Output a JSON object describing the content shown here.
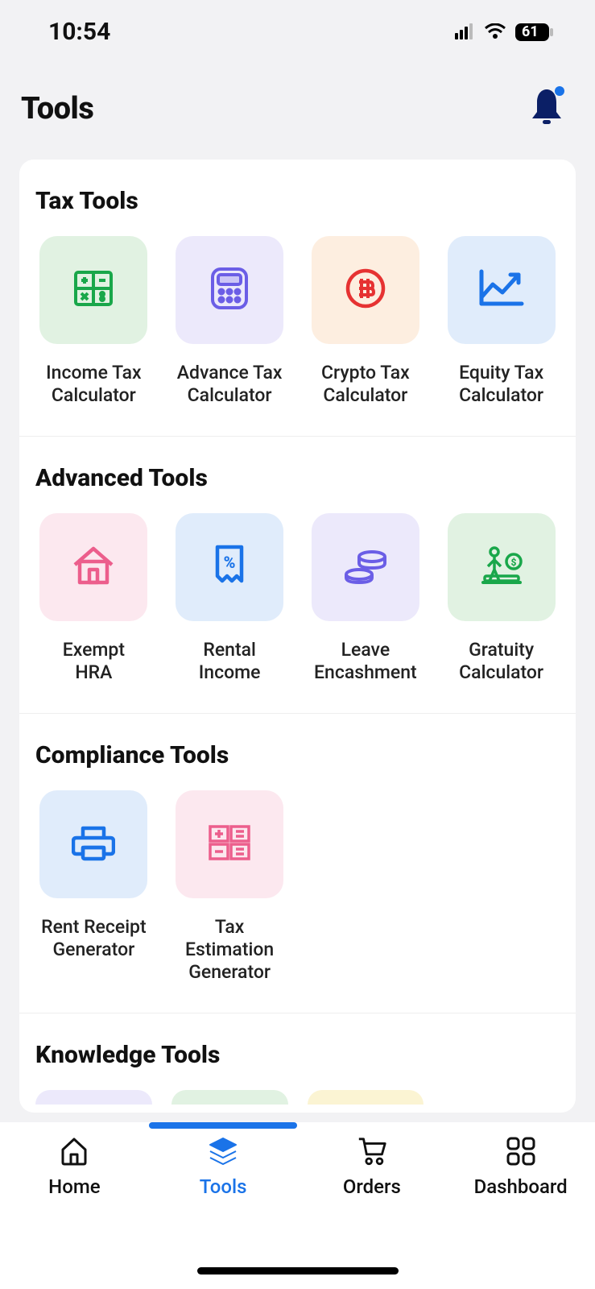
{
  "statusbar": {
    "time": "10:54",
    "battery": "61"
  },
  "header": {
    "title": "Tools"
  },
  "sections": {
    "tax": {
      "title": "Tax Tools"
    },
    "advanced": {
      "title": "Advanced Tools"
    },
    "compliance": {
      "title": "Compliance Tools"
    },
    "knowledge": {
      "title": "Knowledge Tools"
    }
  },
  "tools": {
    "tax": [
      {
        "label": "Income Tax\nCalculator"
      },
      {
        "label": "Advance Tax\nCalculator"
      },
      {
        "label": "Crypto Tax\nCalculator"
      },
      {
        "label": "Equity Tax\nCalculator"
      }
    ],
    "advanced": [
      {
        "label": "Exempt\nHRA"
      },
      {
        "label": "Rental\nIncome"
      },
      {
        "label": "Leave\nEncashment"
      },
      {
        "label": "Gratuity\nCalculator"
      }
    ],
    "compliance": [
      {
        "label": "Rent Receipt\nGenerator"
      },
      {
        "label": "Tax Estimation\nGenerator"
      }
    ]
  },
  "nav": {
    "home": {
      "label": "Home"
    },
    "tools": {
      "label": "Tools"
    },
    "orders": {
      "label": "Orders"
    },
    "dash": {
      "label": "Dashboard"
    }
  }
}
